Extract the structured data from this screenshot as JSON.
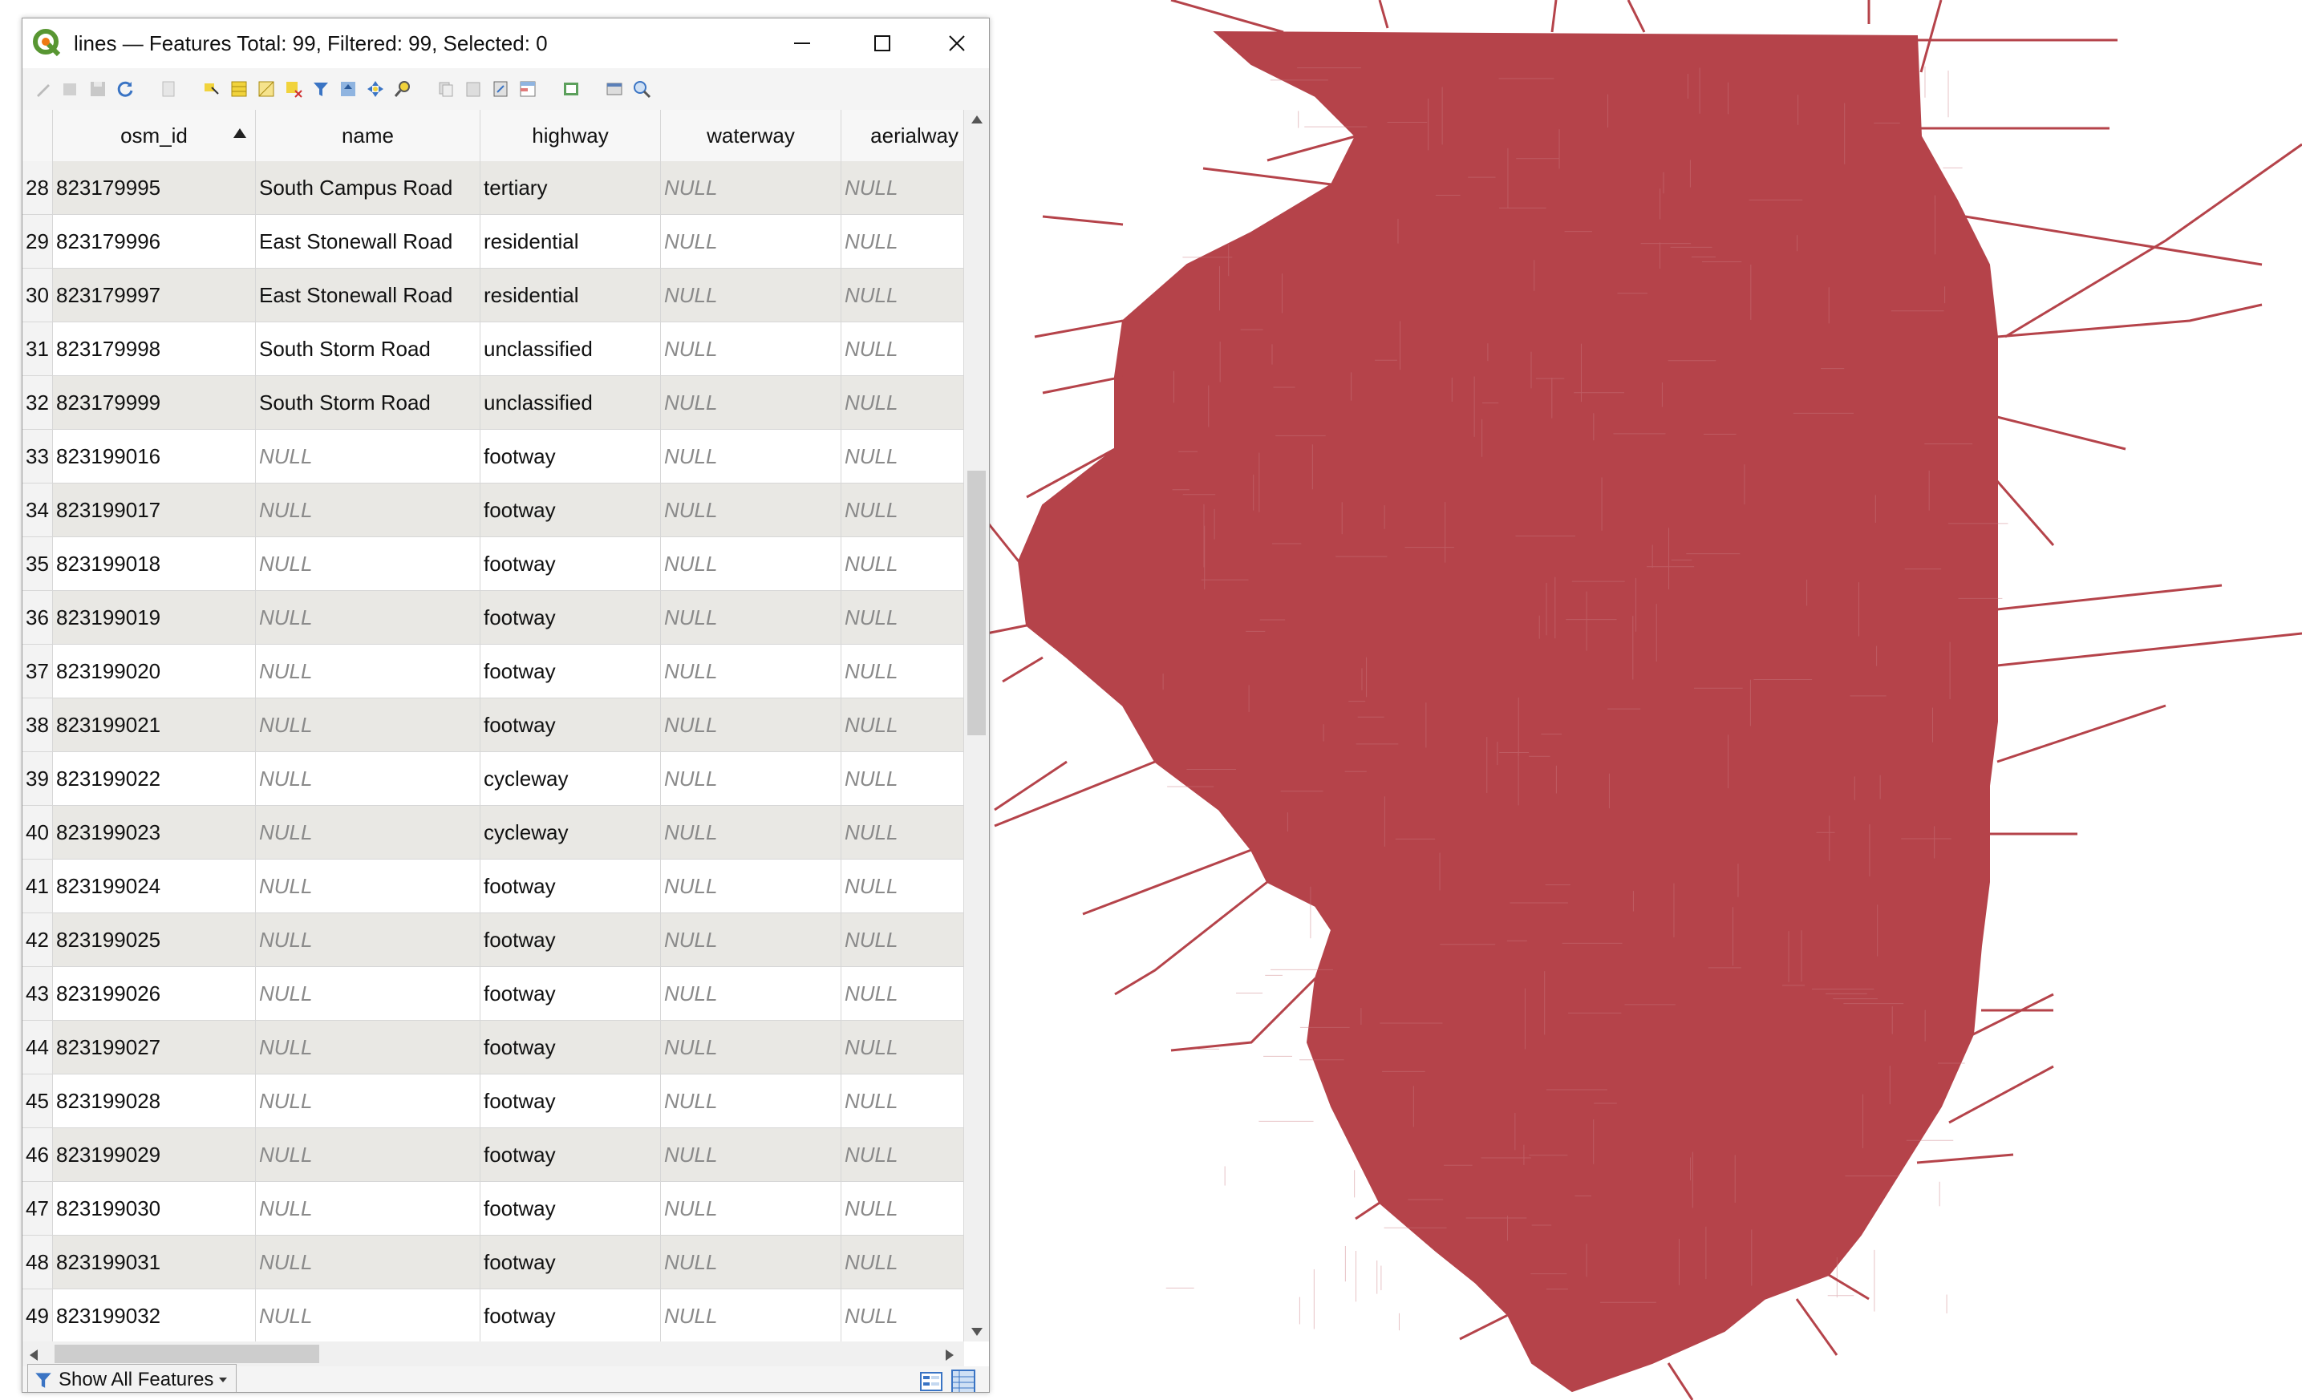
{
  "window": {
    "title": "lines — Features Total: 99, Filtered: 99, Selected: 0"
  },
  "toolbar": {
    "icons": [
      "pencil-icon",
      "edit-icon",
      "save-icon",
      "refresh-icon",
      "new-feature-icon",
      "delete-icon",
      "select-icon",
      "select-all-icon",
      "invert-selection-icon",
      "deselect-icon",
      "filter-icon",
      "move-to-top-icon",
      "pan-icon",
      "zoom-to-selection-icon",
      "copy-icon",
      "paste-icon",
      "field-calculator-icon",
      "conditional-format-icon",
      "dock-icon",
      "actions-icon",
      "zoom-icon"
    ]
  },
  "table": {
    "columns": [
      "osm_id",
      "name",
      "highway",
      "waterway",
      "aerialway"
    ],
    "rows": [
      {
        "n": "28",
        "osm_id": "823179995",
        "name": "South Campus Road",
        "highway": "tertiary",
        "waterway": "NULL",
        "aerialway": "NULL"
      },
      {
        "n": "29",
        "osm_id": "823179996",
        "name": "East Stonewall Road",
        "highway": "residential",
        "waterway": "NULL",
        "aerialway": "NULL"
      },
      {
        "n": "30",
        "osm_id": "823179997",
        "name": "East Stonewall Road",
        "highway": "residential",
        "waterway": "NULL",
        "aerialway": "NULL"
      },
      {
        "n": "31",
        "osm_id": "823179998",
        "name": "South Storm Road",
        "highway": "unclassified",
        "waterway": "NULL",
        "aerialway": "NULL"
      },
      {
        "n": "32",
        "osm_id": "823179999",
        "name": "South Storm Road",
        "highway": "unclassified",
        "waterway": "NULL",
        "aerialway": "NULL"
      },
      {
        "n": "33",
        "osm_id": "823199016",
        "name": "NULL",
        "highway": "footway",
        "waterway": "NULL",
        "aerialway": "NULL"
      },
      {
        "n": "34",
        "osm_id": "823199017",
        "name": "NULL",
        "highway": "footway",
        "waterway": "NULL",
        "aerialway": "NULL"
      },
      {
        "n": "35",
        "osm_id": "823199018",
        "name": "NULL",
        "highway": "footway",
        "waterway": "NULL",
        "aerialway": "NULL"
      },
      {
        "n": "36",
        "osm_id": "823199019",
        "name": "NULL",
        "highway": "footway",
        "waterway": "NULL",
        "aerialway": "NULL"
      },
      {
        "n": "37",
        "osm_id": "823199020",
        "name": "NULL",
        "highway": "footway",
        "waterway": "NULL",
        "aerialway": "NULL"
      },
      {
        "n": "38",
        "osm_id": "823199021",
        "name": "NULL",
        "highway": "footway",
        "waterway": "NULL",
        "aerialway": "NULL"
      },
      {
        "n": "39",
        "osm_id": "823199022",
        "name": "NULL",
        "highway": "cycleway",
        "waterway": "NULL",
        "aerialway": "NULL"
      },
      {
        "n": "40",
        "osm_id": "823199023",
        "name": "NULL",
        "highway": "cycleway",
        "waterway": "NULL",
        "aerialway": "NULL"
      },
      {
        "n": "41",
        "osm_id": "823199024",
        "name": "NULL",
        "highway": "footway",
        "waterway": "NULL",
        "aerialway": "NULL"
      },
      {
        "n": "42",
        "osm_id": "823199025",
        "name": "NULL",
        "highway": "footway",
        "waterway": "NULL",
        "aerialway": "NULL"
      },
      {
        "n": "43",
        "osm_id": "823199026",
        "name": "NULL",
        "highway": "footway",
        "waterway": "NULL",
        "aerialway": "NULL"
      },
      {
        "n": "44",
        "osm_id": "823199027",
        "name": "NULL",
        "highway": "footway",
        "waterway": "NULL",
        "aerialway": "NULL"
      },
      {
        "n": "45",
        "osm_id": "823199028",
        "name": "NULL",
        "highway": "footway",
        "waterway": "NULL",
        "aerialway": "NULL"
      },
      {
        "n": "46",
        "osm_id": "823199029",
        "name": "NULL",
        "highway": "footway",
        "waterway": "NULL",
        "aerialway": "NULL"
      },
      {
        "n": "47",
        "osm_id": "823199030",
        "name": "NULL",
        "highway": "footway",
        "waterway": "NULL",
        "aerialway": "NULL"
      },
      {
        "n": "48",
        "osm_id": "823199031",
        "name": "NULL",
        "highway": "footway",
        "waterway": "NULL",
        "aerialway": "NULL"
      },
      {
        "n": "49",
        "osm_id": "823199032",
        "name": "NULL",
        "highway": "footway",
        "waterway": "NULL",
        "aerialway": "NULL"
      }
    ]
  },
  "footer": {
    "show_all_label": "Show All Features"
  },
  "map": {
    "line_color": "#b5434a"
  }
}
